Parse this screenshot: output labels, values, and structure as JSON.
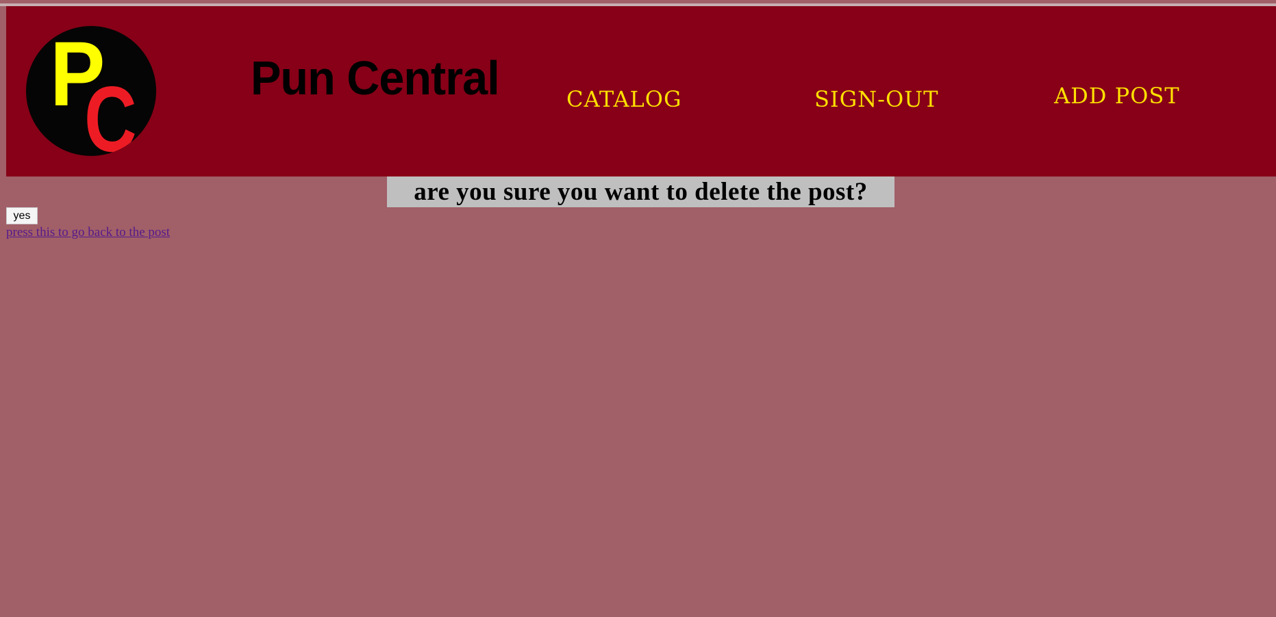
{
  "header": {
    "logo": {
      "letter_p": "P",
      "letter_c": "C",
      "circle_color": "#050505",
      "p_color": "#ffff00",
      "c_color": "#ed1c24"
    },
    "site_title": "Pun Central",
    "background_color": "#870017",
    "nav": [
      {
        "label": "CATALOG"
      },
      {
        "label": "SIGN-OUT"
      },
      {
        "label": "ADD POST"
      }
    ],
    "nav_color": "#ffe000"
  },
  "main": {
    "confirm_message": "are you sure you want to delete the post?",
    "yes_label": "yes",
    "back_link_label": "press this to go back to the post",
    "page_background": "#a15f68"
  }
}
